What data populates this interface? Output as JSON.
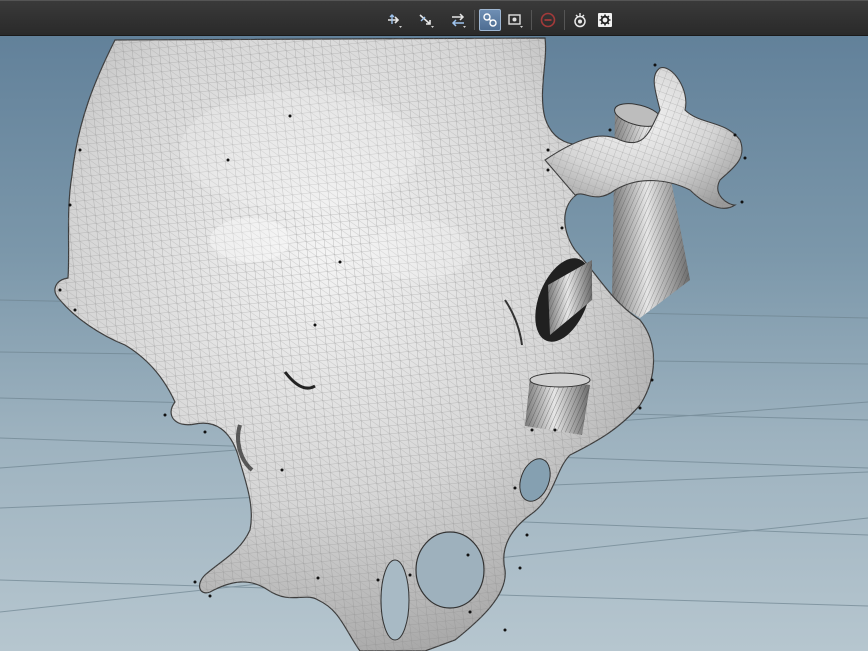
{
  "app": {
    "theme": {
      "toolbar_bg": "#323232",
      "viewport_top": "#62819a",
      "viewport_bottom": "#b6c6cf",
      "mesh_fill": "#d8d8d8",
      "mesh_wire": "#8e8e8e",
      "grid_line": "#6d7f8a",
      "accent_active": "#5f7fa4",
      "disabled_red": "#a33a3a"
    }
  },
  "toolbar": {
    "buttons": [
      {
        "name": "translate-tool-button",
        "icon": "move-arrows-icon",
        "active": false
      },
      {
        "name": "rotate-tool-button",
        "icon": "rotate-arrows-icon",
        "active": false
      },
      {
        "name": "scale-tool-button",
        "icon": "scale-arrows-icon",
        "active": false
      },
      {
        "name": "snapping-toggle-button",
        "icon": "snap-magnet-icon",
        "active": true
      },
      {
        "name": "viewport-display-button",
        "icon": "screen-display-icon",
        "active": false
      },
      {
        "name": "disabled-tool-button",
        "icon": "no-entry-icon",
        "active": false
      },
      {
        "name": "camera-view-button",
        "icon": "camera-view-icon",
        "active": false
      },
      {
        "name": "display-options-button",
        "icon": "gear-icon",
        "active": false
      }
    ]
  },
  "viewport": {
    "object": "mesh-wireframe-model"
  }
}
